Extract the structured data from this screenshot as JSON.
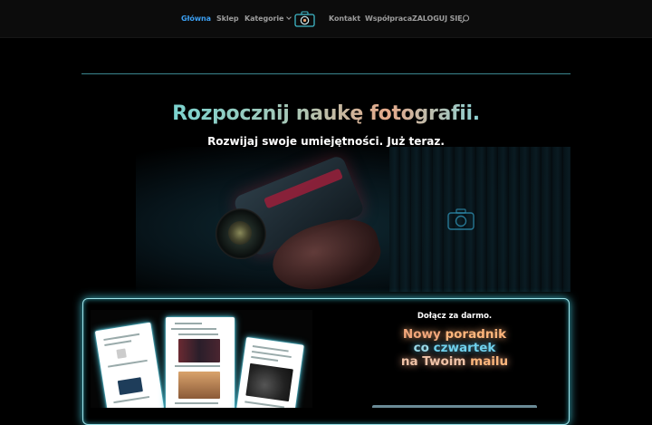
{
  "nav": {
    "items": [
      {
        "label": "Główna",
        "active": true
      },
      {
        "label": "Sklep"
      },
      {
        "label": "Kategorie",
        "has_dropdown": true
      },
      {
        "label": "Kontakt"
      },
      {
        "label": "Współpraca"
      },
      {
        "label": "ZALOGUJ SIĘ"
      }
    ],
    "logo_icon": "camera-logo-icon",
    "search_icon": "search-icon"
  },
  "hero": {
    "title": "Rozpocznij naukę fotografii.",
    "subtitle": "Rozwijaj swoje umiejętności. Już teraz."
  },
  "signup": {
    "join_label": "Dołącz za darmo.",
    "promo_line1_a": "Nowy ",
    "promo_line1_b": "poradnik",
    "promo_line2_a": "co ",
    "promo_line2_b": "czwartek",
    "promo_line3_a": "na Twoim ",
    "promo_line3_b": "mailu"
  },
  "colors": {
    "accent": "#3b9ff2",
    "nav_text": "#9c9c9c",
    "card_glow": "#3fb8c8",
    "background": "#000000"
  }
}
